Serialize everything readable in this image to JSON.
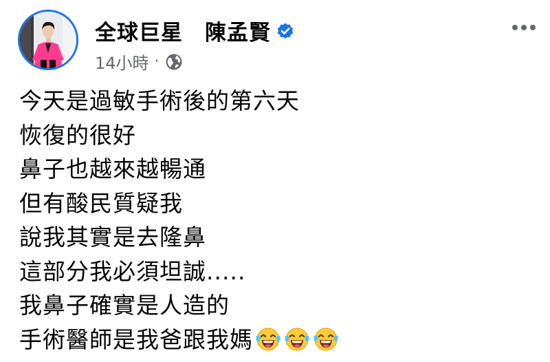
{
  "post": {
    "page_name": "全球巨星　陳孟賢",
    "timestamp": "14小時",
    "separator": "·",
    "audience_icon": "globe-icon",
    "verified_icon": "verified-badge-icon",
    "more_icon": "more-horizontal-icon",
    "lines": [
      "今天是過敏手術後的第六天",
      "恢復的很好",
      "鼻子也越來越暢通",
      "但有酸民質疑我",
      "說我其實是去隆鼻",
      "這部分我必須坦誠.....",
      "我鼻子確實是人造的",
      "手術醫師是我爸跟我媽"
    ],
    "trailing_emoji": [
      "face-with-tears-of-joy",
      "face-with-tears-of-joy",
      "face-with-tears-of-joy"
    ]
  },
  "colors": {
    "accent": "#1b74e4",
    "text": "#050505",
    "secondary_text": "#65676b",
    "avatar_suit": "#ff3c8e"
  }
}
